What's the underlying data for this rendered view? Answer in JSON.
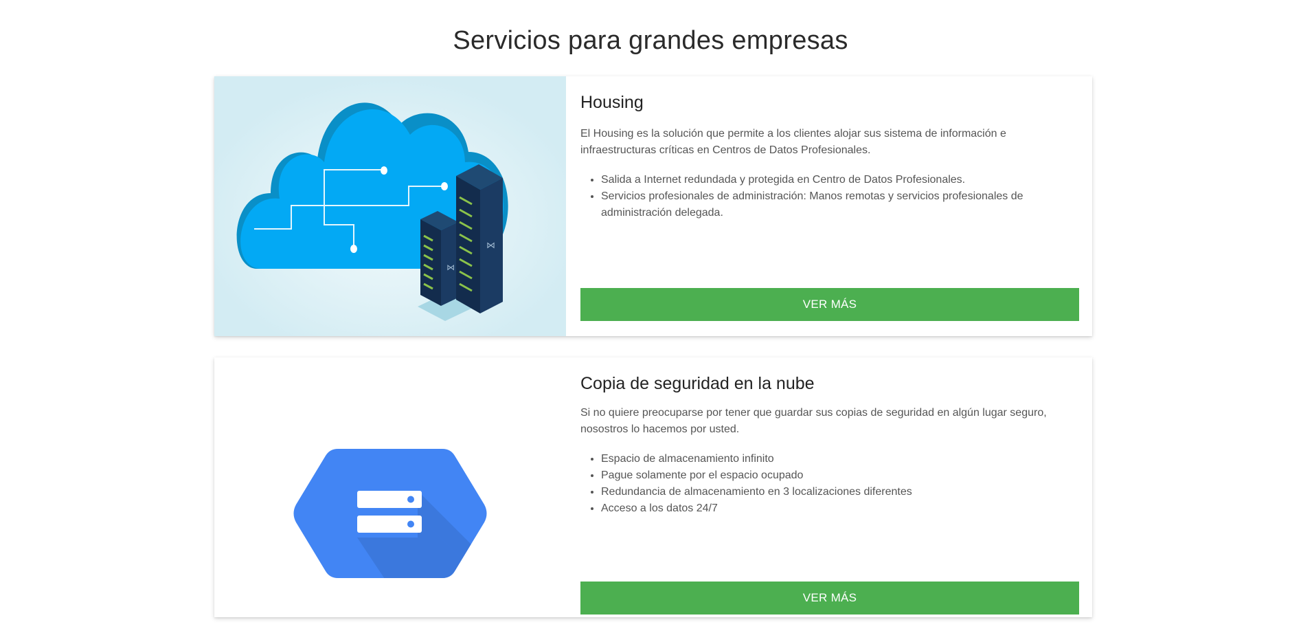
{
  "page": {
    "title": "Servicios para grandes empresas"
  },
  "services": [
    {
      "title": "Housing",
      "description": "El Housing es la solución que permite a los clientes alojar sus sistema de información e infraestructuras críticas en Centros de Datos Profesionales.",
      "features": [
        "Salida a Internet redundada y protegida en Centro de Datos Profesionales.",
        "Servicios profesionales de administración: Manos remotas y servicios profesionales de administración delegada."
      ],
      "button_label": "VER MÁS",
      "icon": "cloud-servers-illustration"
    },
    {
      "title": "Copia de seguridad en la nube",
      "description": "Si no quiere preocuparse por tener que guardar sus copias de seguridad en algún lugar seguro, nosostros lo hacemos por usted.",
      "features": [
        "Espacio de almacenamiento infinito",
        "Pague solamente por el espacio ocupado",
        "Redundancia de almacenamiento en 3 localizaciones diferentes",
        "Acceso a los datos 24/7"
      ],
      "button_label": "VER MÁS",
      "icon": "cloud-storage-hexagon-icon"
    }
  ],
  "colors": {
    "button": "#4caf50",
    "housing_bg": "#d3ecf3",
    "cloud": "#03a9f4",
    "storage_hex": "#4285f4"
  }
}
